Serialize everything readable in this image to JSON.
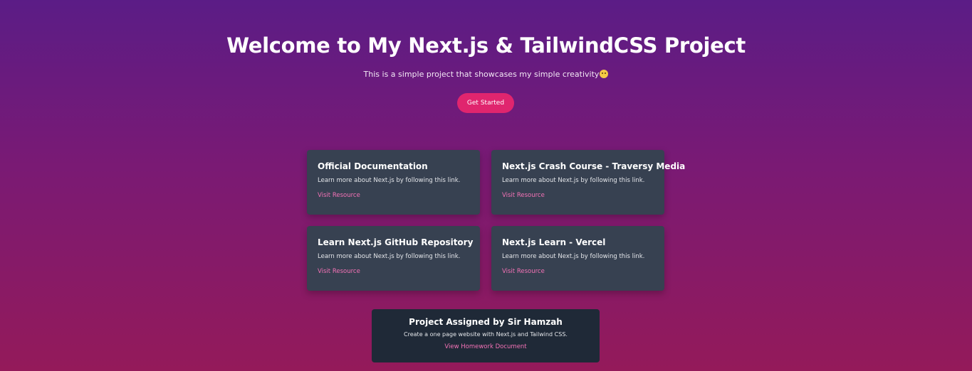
{
  "hero": {
    "title": "Welcome to My Next.js & TailwindCSS Project",
    "subtitle": "This is a simple project that showcases my simple creativity",
    "emoji_icon": "smiling-face-icon",
    "cta_label": "Get Started"
  },
  "resources": [
    {
      "title": "Official Documentation",
      "description": "Learn more about Next.js by following this link.",
      "link_label": "Visit Resource"
    },
    {
      "title": "Next.js Crash Course - Traversy Media",
      "description": "Learn more about Next.js by following this link.",
      "link_label": "Visit Resource"
    },
    {
      "title": "Learn Next.js GitHub Repository",
      "description": "Learn more about Next.js by following this link.",
      "link_label": "Visit Resource"
    },
    {
      "title": "Next.js Learn - Vercel",
      "description": "Learn more about Next.js by following this link.",
      "link_label": "Visit Resource"
    }
  ],
  "assignment": {
    "title": "Project Assigned by Sir Hamzah",
    "description": "Create a one page website with Next.js and Tailwind CSS.",
    "link_label": "View Homework Document"
  },
  "colors": {
    "gradient_top": "#5b1c86",
    "gradient_bottom": "#941a5a",
    "cta": "#e0256e",
    "card_bg": "#374151",
    "assignment_bg": "#1f2937",
    "link": "#f472b6"
  }
}
